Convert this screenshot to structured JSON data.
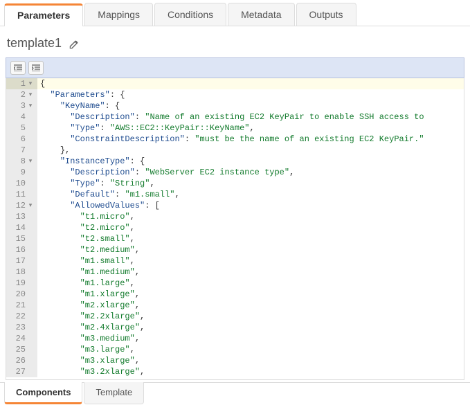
{
  "top_tabs": {
    "items": [
      {
        "label": "Parameters",
        "active": true
      },
      {
        "label": "Mappings",
        "active": false
      },
      {
        "label": "Conditions",
        "active": false
      },
      {
        "label": "Metadata",
        "active": false
      },
      {
        "label": "Outputs",
        "active": false
      }
    ]
  },
  "template": {
    "name": "template1"
  },
  "code": {
    "lines": [
      {
        "n": 1,
        "fold": "▾",
        "active": true,
        "tokens": [
          {
            "t": "punct",
            "v": "{"
          }
        ]
      },
      {
        "n": 2,
        "fold": "▾",
        "tokens": [
          {
            "t": "plain",
            "v": "  "
          },
          {
            "t": "key",
            "v": "\"Parameters\""
          },
          {
            "t": "punct",
            "v": ": {"
          }
        ]
      },
      {
        "n": 3,
        "fold": "▾",
        "tokens": [
          {
            "t": "plain",
            "v": "    "
          },
          {
            "t": "key",
            "v": "\"KeyName\""
          },
          {
            "t": "punct",
            "v": ": {"
          }
        ]
      },
      {
        "n": 4,
        "tokens": [
          {
            "t": "plain",
            "v": "      "
          },
          {
            "t": "key",
            "v": "\"Description\""
          },
          {
            "t": "punct",
            "v": ": "
          },
          {
            "t": "str",
            "v": "\"Name of an existing EC2 KeyPair to enable SSH access to"
          }
        ]
      },
      {
        "n": 5,
        "tokens": [
          {
            "t": "plain",
            "v": "      "
          },
          {
            "t": "key",
            "v": "\"Type\""
          },
          {
            "t": "punct",
            "v": ": "
          },
          {
            "t": "str",
            "v": "\"AWS::EC2::KeyPair::KeyName\""
          },
          {
            "t": "punct",
            "v": ","
          }
        ]
      },
      {
        "n": 6,
        "tokens": [
          {
            "t": "plain",
            "v": "      "
          },
          {
            "t": "key",
            "v": "\"ConstraintDescription\""
          },
          {
            "t": "punct",
            "v": ": "
          },
          {
            "t": "str",
            "v": "\"must be the name of an existing EC2 KeyPair.\""
          }
        ]
      },
      {
        "n": 7,
        "tokens": [
          {
            "t": "plain",
            "v": "    "
          },
          {
            "t": "punct",
            "v": "},"
          }
        ]
      },
      {
        "n": 8,
        "fold": "▾",
        "tokens": [
          {
            "t": "plain",
            "v": "    "
          },
          {
            "t": "key",
            "v": "\"InstanceType\""
          },
          {
            "t": "punct",
            "v": ": {"
          }
        ]
      },
      {
        "n": 9,
        "tokens": [
          {
            "t": "plain",
            "v": "      "
          },
          {
            "t": "key",
            "v": "\"Description\""
          },
          {
            "t": "punct",
            "v": ": "
          },
          {
            "t": "str",
            "v": "\"WebServer EC2 instance type\""
          },
          {
            "t": "punct",
            "v": ","
          }
        ]
      },
      {
        "n": 10,
        "tokens": [
          {
            "t": "plain",
            "v": "      "
          },
          {
            "t": "key",
            "v": "\"Type\""
          },
          {
            "t": "punct",
            "v": ": "
          },
          {
            "t": "str",
            "v": "\"String\""
          },
          {
            "t": "punct",
            "v": ","
          }
        ]
      },
      {
        "n": 11,
        "tokens": [
          {
            "t": "plain",
            "v": "      "
          },
          {
            "t": "key",
            "v": "\"Default\""
          },
          {
            "t": "punct",
            "v": ": "
          },
          {
            "t": "str",
            "v": "\"m1.small\""
          },
          {
            "t": "punct",
            "v": ","
          }
        ]
      },
      {
        "n": 12,
        "fold": "▾",
        "tokens": [
          {
            "t": "plain",
            "v": "      "
          },
          {
            "t": "key",
            "v": "\"AllowedValues\""
          },
          {
            "t": "punct",
            "v": ": ["
          }
        ]
      },
      {
        "n": 13,
        "tokens": [
          {
            "t": "plain",
            "v": "        "
          },
          {
            "t": "str",
            "v": "\"t1.micro\""
          },
          {
            "t": "punct",
            "v": ","
          }
        ]
      },
      {
        "n": 14,
        "tokens": [
          {
            "t": "plain",
            "v": "        "
          },
          {
            "t": "str",
            "v": "\"t2.micro\""
          },
          {
            "t": "punct",
            "v": ","
          }
        ]
      },
      {
        "n": 15,
        "tokens": [
          {
            "t": "plain",
            "v": "        "
          },
          {
            "t": "str",
            "v": "\"t2.small\""
          },
          {
            "t": "punct",
            "v": ","
          }
        ]
      },
      {
        "n": 16,
        "tokens": [
          {
            "t": "plain",
            "v": "        "
          },
          {
            "t": "str",
            "v": "\"t2.medium\""
          },
          {
            "t": "punct",
            "v": ","
          }
        ]
      },
      {
        "n": 17,
        "tokens": [
          {
            "t": "plain",
            "v": "        "
          },
          {
            "t": "str",
            "v": "\"m1.small\""
          },
          {
            "t": "punct",
            "v": ","
          }
        ]
      },
      {
        "n": 18,
        "tokens": [
          {
            "t": "plain",
            "v": "        "
          },
          {
            "t": "str",
            "v": "\"m1.medium\""
          },
          {
            "t": "punct",
            "v": ","
          }
        ]
      },
      {
        "n": 19,
        "tokens": [
          {
            "t": "plain",
            "v": "        "
          },
          {
            "t": "str",
            "v": "\"m1.large\""
          },
          {
            "t": "punct",
            "v": ","
          }
        ]
      },
      {
        "n": 20,
        "tokens": [
          {
            "t": "plain",
            "v": "        "
          },
          {
            "t": "str",
            "v": "\"m1.xlarge\""
          },
          {
            "t": "punct",
            "v": ","
          }
        ]
      },
      {
        "n": 21,
        "tokens": [
          {
            "t": "plain",
            "v": "        "
          },
          {
            "t": "str",
            "v": "\"m2.xlarge\""
          },
          {
            "t": "punct",
            "v": ","
          }
        ]
      },
      {
        "n": 22,
        "tokens": [
          {
            "t": "plain",
            "v": "        "
          },
          {
            "t": "str",
            "v": "\"m2.2xlarge\""
          },
          {
            "t": "punct",
            "v": ","
          }
        ]
      },
      {
        "n": 23,
        "tokens": [
          {
            "t": "plain",
            "v": "        "
          },
          {
            "t": "str",
            "v": "\"m2.4xlarge\""
          },
          {
            "t": "punct",
            "v": ","
          }
        ]
      },
      {
        "n": 24,
        "tokens": [
          {
            "t": "plain",
            "v": "        "
          },
          {
            "t": "str",
            "v": "\"m3.medium\""
          },
          {
            "t": "punct",
            "v": ","
          }
        ]
      },
      {
        "n": 25,
        "tokens": [
          {
            "t": "plain",
            "v": "        "
          },
          {
            "t": "str",
            "v": "\"m3.large\""
          },
          {
            "t": "punct",
            "v": ","
          }
        ]
      },
      {
        "n": 26,
        "tokens": [
          {
            "t": "plain",
            "v": "        "
          },
          {
            "t": "str",
            "v": "\"m3.xlarge\""
          },
          {
            "t": "punct",
            "v": ","
          }
        ]
      },
      {
        "n": 27,
        "tokens": [
          {
            "t": "plain",
            "v": "        "
          },
          {
            "t": "str",
            "v": "\"m3.2xlarge\""
          },
          {
            "t": "punct",
            "v": ","
          }
        ]
      }
    ]
  },
  "bottom_tabs": {
    "items": [
      {
        "label": "Components",
        "active": true
      },
      {
        "label": "Template",
        "active": false
      }
    ]
  }
}
